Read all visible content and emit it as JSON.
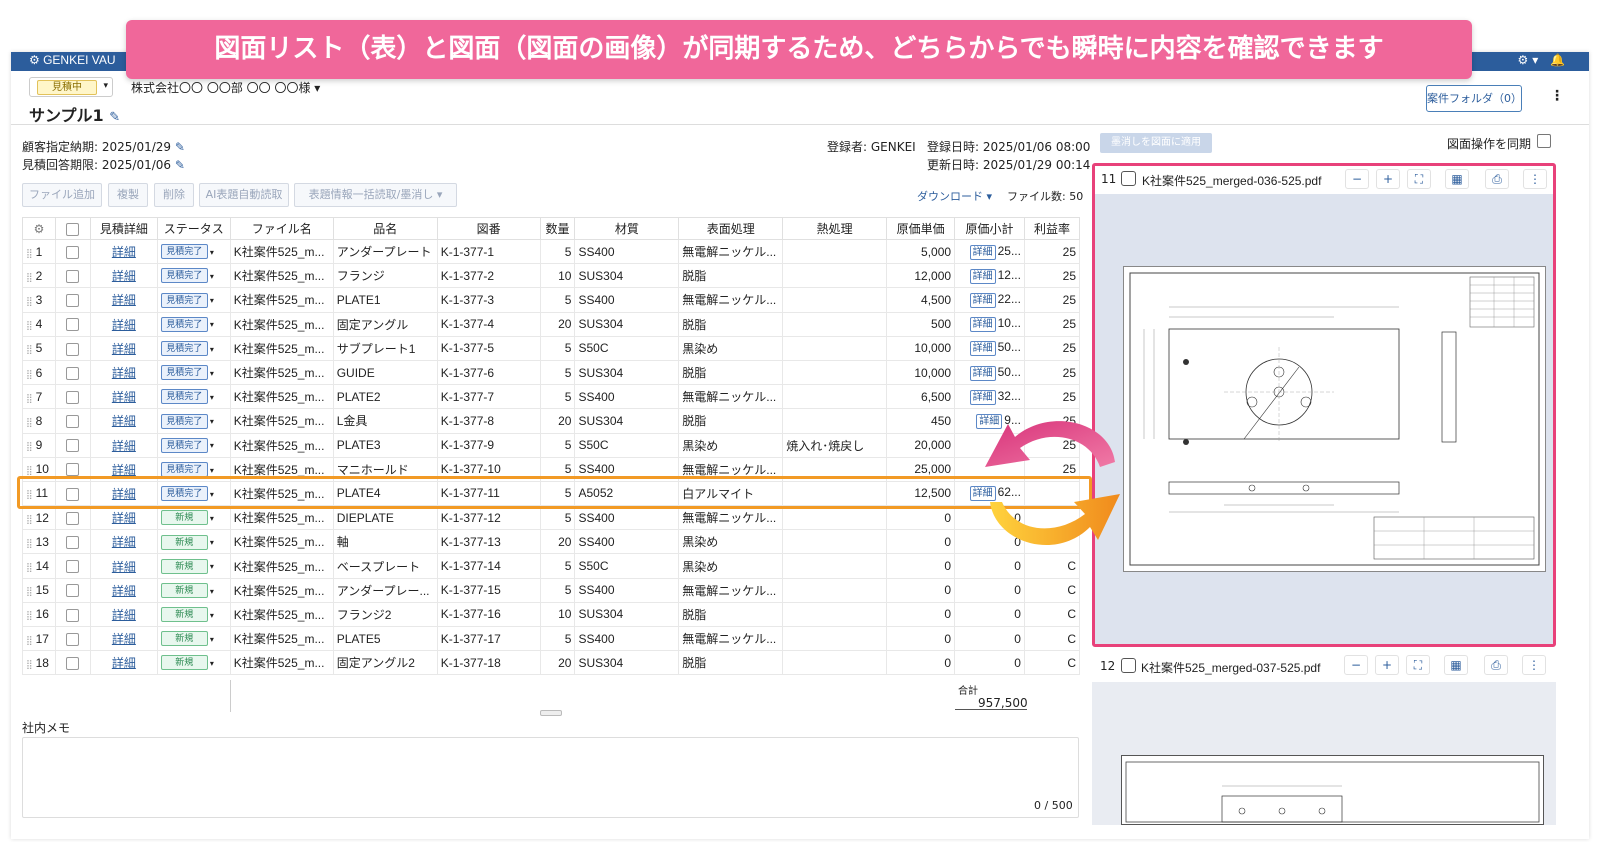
{
  "banner": {
    "text": "図面リスト（表）と図面（図面の画像）が同期するため、どちらからでも瞬時に内容を確認できます"
  },
  "topbar": {
    "brand": "GENKEI VAU"
  },
  "header": {
    "status_label": "見積中",
    "customer": "株式会社〇〇 〇〇部 〇〇 〇〇様",
    "title": "サンプル1",
    "folder_button": "案件フォルダ（0）"
  },
  "meta": {
    "due_label": "顧客指定納期: 2025/01/29",
    "reply_label": "見積回答期限: 2025/01/06",
    "registrant": "登録者: GENKEI",
    "registered_at": "登録日時: 2025/01/06 08:00",
    "updated_at": "更新日時: 2025/01/29 00:14"
  },
  "toolbar": {
    "add_file": "ファイル追加",
    "copy": "複製",
    "delete": "削除",
    "ai_read": "AI表題自動読取",
    "bulk": "表題情報一括読取/墨消し",
    "download": "ダウンロード",
    "file_count": "ファイル数: 50"
  },
  "table": {
    "headers": [
      "",
      "",
      "見積詳細",
      "ステータス",
      "ファイル名",
      "品名",
      "図番",
      "数量",
      "材質",
      "表面処理",
      "熱処理",
      "原価単価",
      "原価小計",
      "利益率"
    ],
    "rows": [
      {
        "no": "1",
        "detail": "詳細",
        "status": "見積完了",
        "file": "K社案件525_m...",
        "name": "アンダープレート",
        "drawing": "K-1-377-1",
        "qty": "5",
        "material": "SS400",
        "surface": "無電解ニッケル...",
        "heat": "",
        "unit": "5,000",
        "sub": "25...",
        "rate": "25",
        "kind": "done"
      },
      {
        "no": "2",
        "detail": "詳細",
        "status": "見積完了",
        "file": "K社案件525_m...",
        "name": "フランジ",
        "drawing": "K-1-377-2",
        "qty": "10",
        "material": "SUS304",
        "surface": "脱脂",
        "heat": "",
        "unit": "12,000",
        "sub": "12...",
        "rate": "25",
        "kind": "done"
      },
      {
        "no": "3",
        "detail": "詳細",
        "status": "見積完了",
        "file": "K社案件525_m...",
        "name": "PLATE1",
        "drawing": "K-1-377-3",
        "qty": "5",
        "material": "SS400",
        "surface": "無電解ニッケル...",
        "heat": "",
        "unit": "4,500",
        "sub": "22...",
        "rate": "25",
        "kind": "done"
      },
      {
        "no": "4",
        "detail": "詳細",
        "status": "見積完了",
        "file": "K社案件525_m...",
        "name": "固定アングル",
        "drawing": "K-1-377-4",
        "qty": "20",
        "material": "SUS304",
        "surface": "脱脂",
        "heat": "",
        "unit": "500",
        "sub": "10...",
        "rate": "25",
        "kind": "done"
      },
      {
        "no": "5",
        "detail": "詳細",
        "status": "見積完了",
        "file": "K社案件525_m...",
        "name": "サブプレート1",
        "drawing": "K-1-377-5",
        "qty": "5",
        "material": "S50C",
        "surface": "黒染め",
        "heat": "",
        "unit": "10,000",
        "sub": "50...",
        "rate": "25",
        "kind": "done"
      },
      {
        "no": "6",
        "detail": "詳細",
        "status": "見積完了",
        "file": "K社案件525_m...",
        "name": "GUIDE",
        "drawing": "K-1-377-6",
        "qty": "5",
        "material": "SUS304",
        "surface": "脱脂",
        "heat": "",
        "unit": "10,000",
        "sub": "50...",
        "rate": "25",
        "kind": "done"
      },
      {
        "no": "7",
        "detail": "詳細",
        "status": "見積完了",
        "file": "K社案件525_m...",
        "name": "PLATE2",
        "drawing": "K-1-377-7",
        "qty": "5",
        "material": "SS400",
        "surface": "無電解ニッケル...",
        "heat": "",
        "unit": "6,500",
        "sub": "32...",
        "rate": "25",
        "kind": "done"
      },
      {
        "no": "8",
        "detail": "詳細",
        "status": "見積完了",
        "file": "K社案件525_m...",
        "name": "L金具",
        "drawing": "K-1-377-8",
        "qty": "20",
        "material": "SUS304",
        "surface": "脱脂",
        "heat": "",
        "unit": "450",
        "sub": "9...",
        "rate": "25",
        "kind": "done"
      },
      {
        "no": "9",
        "detail": "詳細",
        "status": "見積完了",
        "file": "K社案件525_m...",
        "name": "PLATE3",
        "drawing": "K-1-377-9",
        "qty": "5",
        "material": "S50C",
        "surface": "黒染め",
        "heat": "焼入れ･焼戻し",
        "unit": "20,000",
        "sub": "",
        "rate": "25",
        "kind": "done"
      },
      {
        "no": "10",
        "detail": "詳細",
        "status": "見積完了",
        "file": "K社案件525_m...",
        "name": "マニホールド",
        "drawing": "K-1-377-10",
        "qty": "5",
        "material": "SS400",
        "surface": "無電解ニッケル...",
        "heat": "",
        "unit": "25,000",
        "sub": "",
        "rate": "25",
        "kind": "done"
      },
      {
        "no": "11",
        "detail": "詳細",
        "status": "見積完了",
        "file": "K社案件525_m...",
        "name": "PLATE4",
        "drawing": "K-1-377-11",
        "qty": "5",
        "material": "A5052",
        "surface": "白アルマイト",
        "heat": "",
        "unit": "12,500",
        "sub": "62...",
        "rate": "",
        "kind": "done"
      },
      {
        "no": "12",
        "detail": "詳細",
        "status": "新規",
        "file": "K社案件525_m...",
        "name": "DIEPLATE",
        "drawing": "K-1-377-12",
        "qty": "5",
        "material": "SS400",
        "surface": "無電解ニッケル...",
        "heat": "",
        "unit": "0",
        "sub": "0",
        "rate": "",
        "kind": "new"
      },
      {
        "no": "13",
        "detail": "詳細",
        "status": "新規",
        "file": "K社案件525_m...",
        "name": "軸",
        "drawing": "K-1-377-13",
        "qty": "20",
        "material": "SS400",
        "surface": "黒染め",
        "heat": "",
        "unit": "0",
        "sub": "0",
        "rate": "",
        "kind": "new"
      },
      {
        "no": "14",
        "detail": "詳細",
        "status": "新規",
        "file": "K社案件525_m...",
        "name": "ベースプレート",
        "drawing": "K-1-377-14",
        "qty": "5",
        "material": "S50C",
        "surface": "黒染め",
        "heat": "",
        "unit": "0",
        "sub": "0",
        "rate": "C",
        "kind": "new"
      },
      {
        "no": "15",
        "detail": "詳細",
        "status": "新規",
        "file": "K社案件525_m...",
        "name": "アンダープレー...",
        "drawing": "K-1-377-15",
        "qty": "5",
        "material": "SS400",
        "surface": "無電解ニッケル...",
        "heat": "",
        "unit": "0",
        "sub": "0",
        "rate": "C",
        "kind": "new"
      },
      {
        "no": "16",
        "detail": "詳細",
        "status": "新規",
        "file": "K社案件525_m...",
        "name": "フランジ2",
        "drawing": "K-1-377-16",
        "qty": "10",
        "material": "SUS304",
        "surface": "脱脂",
        "heat": "",
        "unit": "0",
        "sub": "0",
        "rate": "C",
        "kind": "new"
      },
      {
        "no": "17",
        "detail": "詳細",
        "status": "新規",
        "file": "K社案件525_m...",
        "name": "PLATE5",
        "drawing": "K-1-377-17",
        "qty": "5",
        "material": "SS400",
        "surface": "無電解ニッケル...",
        "heat": "",
        "unit": "0",
        "sub": "0",
        "rate": "C",
        "kind": "new"
      },
      {
        "no": "18",
        "detail": "詳細",
        "status": "新規",
        "file": "K社案件525_m...",
        "name": "固定アングル2",
        "drawing": "K-1-377-18",
        "qty": "20",
        "material": "SUS304",
        "surface": "脱脂",
        "heat": "",
        "unit": "0",
        "sub": "0",
        "rate": "C",
        "kind": "new"
      }
    ],
    "total_label": "合計",
    "total_value": "957,500",
    "detail_button": "詳細"
  },
  "memo": {
    "label": "社内メモ",
    "count": "0 / 500"
  },
  "right": {
    "apply_button": "墨消しを図面に適用",
    "sync_label": "図面操作を同期",
    "pdf1_no": "11",
    "pdf1_name": "K社案件525_merged-036-525.pdf",
    "pdf2_no": "12",
    "pdf2_name": "K社案件525_merged-037-525.pdf",
    "tools": [
      "−",
      "+",
      "⛶",
      "▦",
      "⎙",
      "⋮"
    ]
  },
  "colors": {
    "banner": "#f0679a",
    "highlight_row": "#f29a25",
    "pdf_frame": "#e8417a",
    "topbar": "#2c5d9c"
  }
}
